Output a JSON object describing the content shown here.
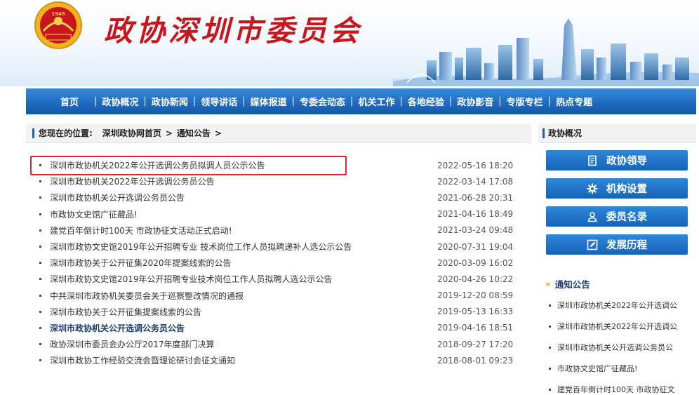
{
  "header": {
    "site_title": "政协深圳市委员会",
    "emblem_year": "1949"
  },
  "nav": {
    "items": [
      "首页",
      "政协概况",
      "政协新闻",
      "领导讲话",
      "媒体报道",
      "专委会动态",
      "机关工作",
      "各地经验",
      "政协影音",
      "专版专栏",
      "热点专题"
    ]
  },
  "breadcrumb": {
    "prefix": "您现在的位置:",
    "home": "深圳政协网首页",
    "sep1": ">",
    "section": "通知公告",
    "sep2": ">"
  },
  "list": {
    "rows": [
      {
        "title": "深圳市政协机关2022年公开选调公务员拟调人员公示公告",
        "date": "2022-05-16 18:20"
      },
      {
        "title": "深圳市政协机关2022年公开选调公务员公告",
        "date": "2022-03-14 17:08"
      },
      {
        "title": "深圳市政协机关公开选调公务员公告",
        "date": "2021-06-28 20:31"
      },
      {
        "title": "市政协文史馆广征藏品!",
        "date": "2021-04-16 18:49"
      },
      {
        "title": "建党百年倒计时100天 市政协征文活动正式启动!",
        "date": "2021-03-24 09:48"
      },
      {
        "title": "深圳市政协文史馆2019年公开招聘专业 技术岗位工作人员拟聘递补人选公示公告",
        "date": "2020-07-31 19:04"
      },
      {
        "title": "深圳市政协关于公开征集2020年提案线索的公告",
        "date": "2020-03-09 16:02"
      },
      {
        "title": "深圳市政协文史馆2019年公开招聘专业技术岗位工作人员拟聘人选公示公告",
        "date": "2020-04-26 10:22"
      },
      {
        "title": "中共深圳市政协机关委员会关于巡察整改情况的通报",
        "date": "2019-12-20 08:59"
      },
      {
        "title": "深圳市政协关于公开征集提案线索的公告",
        "date": "2019-05-13 16:33"
      },
      {
        "title": "深圳市政协机关公开选调公务员公告",
        "date": "2019-04-16 18:51"
      },
      {
        "title": "政协深圳市委员会办公厅2017年度部门决算",
        "date": "2018-09-27 17:20"
      },
      {
        "title": "深圳市政协工作经验交流会暨理论研讨会征文通知",
        "date": "2018-08-01 09:23"
      }
    ]
  },
  "sidebar": {
    "heading": "政协概况",
    "buttons": [
      {
        "label": "政协领导",
        "icon": "document-icon"
      },
      {
        "label": "机构设置",
        "icon": "gear-icon"
      },
      {
        "label": "委员名录",
        "icon": "person-icon"
      },
      {
        "label": "发展历程",
        "icon": "edit-icon"
      }
    ],
    "notice_heading": "通知公告",
    "notices": [
      "深圳市政协机关2022年公开选调公",
      "深圳市政协机关2022年公开选调公",
      "深圳市政协机关公开选调公务员公",
      "市政协文史馆广征藏品!",
      "建党百年倒计时100天 市政协征文"
    ]
  },
  "colors": {
    "title_red": "#c8161d",
    "nav_blue": "#1f6cc1",
    "highlight_red": "#e5252b",
    "accent_orange": "#e79d1c"
  }
}
